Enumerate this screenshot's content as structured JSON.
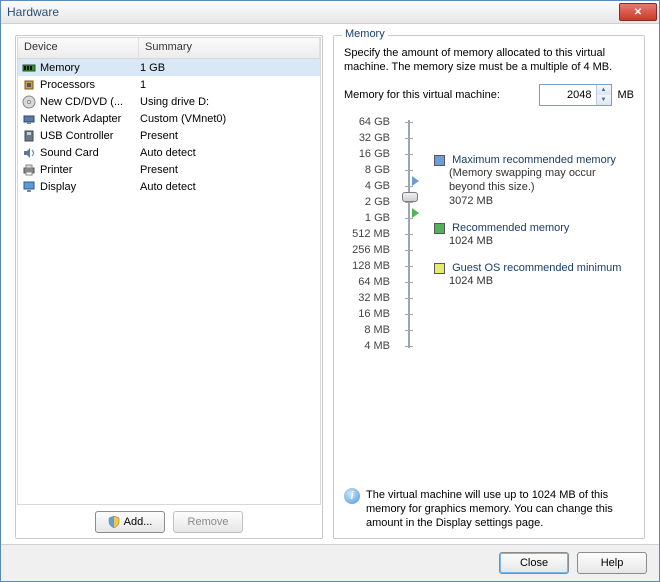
{
  "title": "Hardware",
  "table": {
    "headers": {
      "device": "Device",
      "summary": "Summary"
    },
    "rows": [
      {
        "icon": "memory-icon",
        "label": "Memory",
        "summary": "1 GB",
        "selected": true
      },
      {
        "icon": "processors-icon",
        "label": "Processors",
        "summary": "1"
      },
      {
        "icon": "cd-icon",
        "label": "New CD/DVD (...",
        "summary": "Using drive D:"
      },
      {
        "icon": "network-icon",
        "label": "Network Adapter",
        "summary": "Custom (VMnet0)"
      },
      {
        "icon": "usb-icon",
        "label": "USB Controller",
        "summary": "Present"
      },
      {
        "icon": "sound-icon",
        "label": "Sound Card",
        "summary": "Auto detect"
      },
      {
        "icon": "printer-icon",
        "label": "Printer",
        "summary": "Present"
      },
      {
        "icon": "display-icon",
        "label": "Display",
        "summary": "Auto detect"
      }
    ]
  },
  "buttons": {
    "add": "Add...",
    "remove": "Remove",
    "close": "Close",
    "help": "Help"
  },
  "memory": {
    "group": "Memory",
    "desc": "Specify the amount of memory allocated to this virtual machine. The memory size must be a multiple of 4 MB.",
    "label": "Memory for this virtual machine:",
    "value": "2048",
    "unit": "MB",
    "ticks": [
      "64 GB",
      "32 GB",
      "16 GB",
      "8 GB",
      "4 GB",
      "2 GB",
      "1 GB",
      "512 MB",
      "256 MB",
      "128 MB",
      "64 MB",
      "32 MB",
      "16 MB",
      "8 MB",
      "4 MB"
    ],
    "legend": {
      "max": {
        "title": "Maximum recommended memory",
        "sub": "(Memory swapping may occur beyond this size.)",
        "value": "3072 MB",
        "color": "#6a9ed4"
      },
      "rec": {
        "title": "Recommended memory",
        "value": "1024 MB",
        "color": "#55b155"
      },
      "min": {
        "title": "Guest OS recommended minimum",
        "value": "1024 MB",
        "color": "#e9e96a"
      }
    },
    "info": "The virtual machine will use up to 1024 MB of this memory for graphics memory. You can change this amount in the Display settings page."
  }
}
